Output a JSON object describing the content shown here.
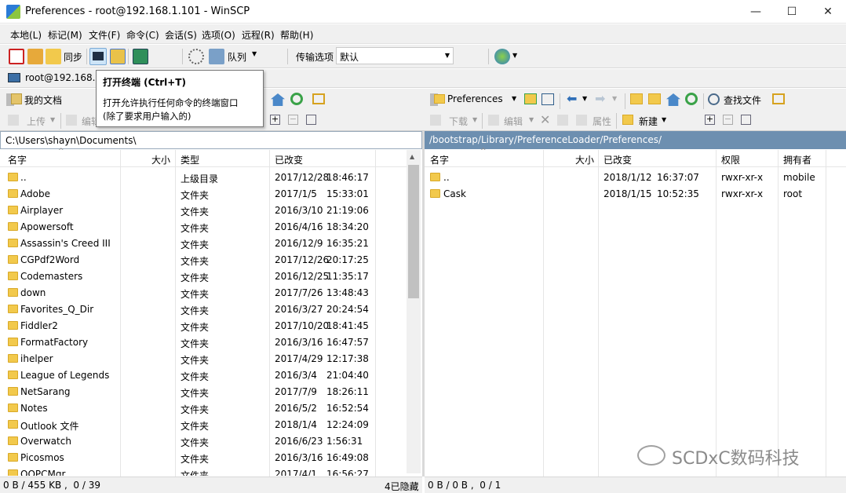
{
  "window": {
    "title": "Preferences - root@192.168.1.101 - WinSCP",
    "minimize": "—",
    "maximize": "☐",
    "close": "✕"
  },
  "menu": [
    "本地(L)",
    "标记(M)",
    "文件(F)",
    "命令(C)",
    "会话(S)",
    "选项(O)",
    "远程(R)",
    "帮助(H)"
  ],
  "toolbar": {
    "sync_label": "同步",
    "queue_label": "队列",
    "transfer_label": "传输选项",
    "transfer_value": "默认"
  },
  "session": {
    "tab_label": "root@192.168.1"
  },
  "tooltip": {
    "title": "打开终端 (Ctrl+T)",
    "line1": "打开允许执行任何命令的终端窗口",
    "line2": "(除了要求用户输入的)"
  },
  "left": {
    "location": "我的文档",
    "actions": {
      "upload": "上传",
      "edit": "编辑"
    },
    "path": "C:\\Users\\shayn\\Documents\\",
    "headers": {
      "name": "名字",
      "size": "大小",
      "type": "类型",
      "changed": "已改变"
    },
    "rows": [
      {
        "name": "..",
        "type": "上级目录",
        "date": "2017/12/28",
        "time": "18:46:17",
        "parent": true
      },
      {
        "name": "Adobe",
        "type": "文件夹",
        "date": "2017/1/5",
        "time": "15:33:01"
      },
      {
        "name": "Airplayer",
        "type": "文件夹",
        "date": "2016/3/10",
        "time": "21:19:06"
      },
      {
        "name": "Apowersoft",
        "type": "文件夹",
        "date": "2016/4/16",
        "time": "18:34:20"
      },
      {
        "name": "Assassin's Creed III",
        "type": "文件夹",
        "date": "2016/12/9",
        "time": "16:35:21"
      },
      {
        "name": "CGPdf2Word",
        "type": "文件夹",
        "date": "2017/12/26",
        "time": "20:17:25"
      },
      {
        "name": "Codemasters",
        "type": "文件夹",
        "date": "2016/12/25",
        "time": "11:35:17"
      },
      {
        "name": "down",
        "type": "文件夹",
        "date": "2017/7/26",
        "time": "13:48:43"
      },
      {
        "name": "Favorites_Q_Dir",
        "type": "文件夹",
        "date": "2016/3/27",
        "time": "20:24:54"
      },
      {
        "name": "Fiddler2",
        "type": "文件夹",
        "date": "2017/10/20",
        "time": "18:41:45"
      },
      {
        "name": "FormatFactory",
        "type": "文件夹",
        "date": "2016/3/16",
        "time": "16:47:57"
      },
      {
        "name": "ihelper",
        "type": "文件夹",
        "date": "2017/4/29",
        "time": "12:17:38"
      },
      {
        "name": "League of Legends",
        "type": "文件夹",
        "date": "2016/3/4",
        "time": "21:04:40"
      },
      {
        "name": "NetSarang",
        "type": "文件夹",
        "date": "2017/7/9",
        "time": "18:26:11"
      },
      {
        "name": "Notes",
        "type": "文件夹",
        "date": "2016/5/2",
        "time": "16:52:54"
      },
      {
        "name": "Outlook 文件",
        "type": "文件夹",
        "date": "2018/1/4",
        "time": "12:24:09"
      },
      {
        "name": "Overwatch",
        "type": "文件夹",
        "date": "2016/6/23",
        "time": "1:56:31"
      },
      {
        "name": "Picosmos",
        "type": "文件夹",
        "date": "2016/3/16",
        "time": "16:49:08"
      },
      {
        "name": "QQPCMgr",
        "type": "文件夹",
        "date": "2017/4/1",
        "time": "16:56:27"
      }
    ],
    "status": "0 B / 455 KB ,  0 / 39",
    "hidden": "4已隐藏"
  },
  "right": {
    "location": "Preferences",
    "find_label": "查找文件",
    "actions": {
      "download": "下载",
      "edit": "编辑",
      "properties": "属性",
      "new": "新建"
    },
    "path": "/bootstrap/Library/PreferenceLoader/Preferences/",
    "headers": {
      "name": "名字",
      "size": "大小",
      "changed": "已改变",
      "rights": "权限",
      "owner": "拥有者"
    },
    "rows": [
      {
        "name": "..",
        "date": "2018/1/12",
        "time": "16:37:07",
        "rights": "rwxr-xr-x",
        "owner": "mobile",
        "parent": true
      },
      {
        "name": "Cask",
        "date": "2018/1/15",
        "time": "10:52:35",
        "rights": "rwxr-xr-x",
        "owner": "root"
      }
    ],
    "status": "0 B / 0 B ,  0 / 1"
  },
  "watermark": "SCDxC数码科技"
}
